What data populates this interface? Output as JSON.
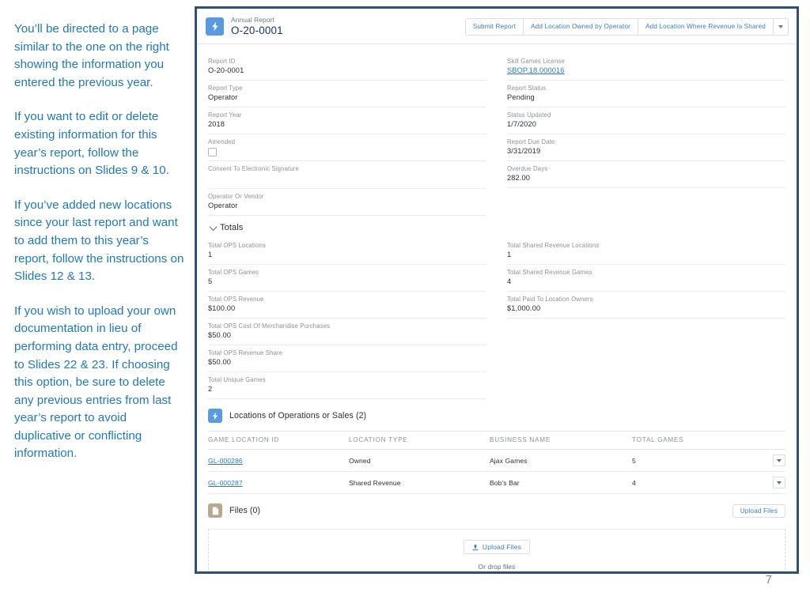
{
  "slide": {
    "page_number": "7",
    "instructions": [
      "You’ll be directed to a page similar to the one on the right showing the information you entered the previous year.",
      "If you want to edit or delete existing information for this year’s report, follow the instructions on Slides 9 & 10.",
      "If you’ve added new locations since your last report and want to add them to this year’s report, follow the instructions on Slides 12 & 13.",
      "If you wish to upload your own documentation in lieu of performing data entry, proceed to Slides 22 & 23. If choosing this option, be sure to delete any previous entries from last year’s report to avoid duplicative  or conflicting information."
    ]
  },
  "colors": {
    "instruction_text": "#1f79b7",
    "frame_border": "#2e5077",
    "brand_blue": "#5a9ae0",
    "link_blue": "#2a7bbd",
    "files_icon": "#baa88d"
  },
  "record_header": {
    "icon": "lightning-bolt-icon",
    "object_label": "Annual Report",
    "record_name": "O-20-0001",
    "actions": [
      {
        "label": "Submit Report"
      },
      {
        "label": "Add Location Owned by Operator"
      },
      {
        "label": "Add Location Where Revenue Is Shared"
      }
    ],
    "overflow_icon": "chevron-down-icon"
  },
  "details": {
    "left_fields": [
      {
        "label": "Report ID",
        "value": "O-20-0001",
        "type": "text"
      },
      {
        "label": "Report Type",
        "value": "Operator",
        "type": "text"
      },
      {
        "label": "Report Year",
        "value": "2018",
        "type": "text"
      },
      {
        "label": "Amended",
        "value": "",
        "type": "checkbox",
        "checked": false
      },
      {
        "label": "Consent To Electronic Signature",
        "value": "",
        "type": "blank"
      },
      {
        "label": "Operator Or Vendor",
        "value": "Operator",
        "type": "text"
      }
    ],
    "right_fields": [
      {
        "label": "Skill Games License",
        "value": "SBOP.18.000016",
        "type": "link"
      },
      {
        "label": "Report Status",
        "value": "Pending",
        "type": "text"
      },
      {
        "label": "Status Updated",
        "value": "1/7/2020",
        "type": "text"
      },
      {
        "label": "Report Due Date",
        "value": "3/31/2019",
        "type": "text"
      },
      {
        "label": "Overdue Days",
        "value": "282.00",
        "type": "text"
      }
    ]
  },
  "totals": {
    "title": "Totals",
    "collapse_icon": "chevron-down-icon",
    "left_fields": [
      {
        "label": "Total OPS Locations",
        "value": "1"
      },
      {
        "label": "Total OPS Games",
        "value": "5"
      },
      {
        "label": "Total OPS Revenue",
        "value": "$100.00"
      },
      {
        "label": "Total OPS Cost Of Merchandise Purchases",
        "value": "$50.00"
      },
      {
        "label": "Total OPS Revenue Share",
        "value": "$50.00"
      },
      {
        "label": "Total Unique Games",
        "value": "2"
      }
    ],
    "right_fields": [
      {
        "label": "Total Shared Revenue Locations",
        "value": "1"
      },
      {
        "label": "Total Shared Revenue Games",
        "value": "4"
      },
      {
        "label": "Total Paid To Location Owners",
        "value": "$1,000.00"
      }
    ]
  },
  "locations_list": {
    "icon": "lightning-bolt-icon",
    "title": "Locations of Operations or Sales (2)",
    "columns": [
      "GAME LOCATION ID",
      "LOCATION TYPE",
      "BUSINESS NAME",
      "TOTAL GAMES"
    ],
    "rows": [
      {
        "game_location_id": "GL-000286",
        "location_type": "Owned",
        "business_name": "Ajax Games",
        "total_games": "5",
        "row_menu_icon": "chevron-down-icon"
      },
      {
        "game_location_id": "GL-000287",
        "location_type": "Shared Revenue",
        "business_name": "Bob's Bar",
        "total_games": "4",
        "row_menu_icon": "chevron-down-icon"
      }
    ]
  },
  "files_list": {
    "icon": "file-icon",
    "title": "Files (0)",
    "header_action": "Upload Files",
    "dropzone_button": "Upload Files",
    "dropzone_button_icon": "upload-icon",
    "dropzone_text": "Or drop files"
  }
}
